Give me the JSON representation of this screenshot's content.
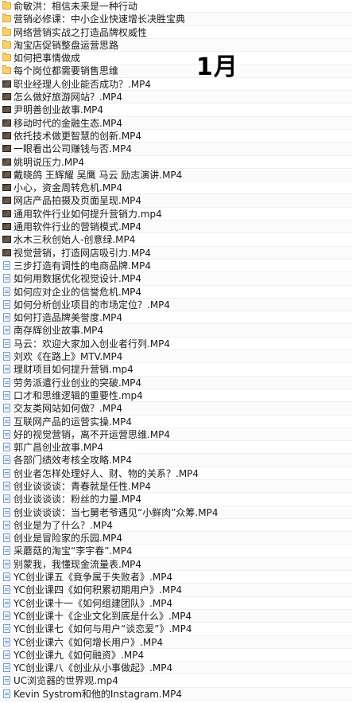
{
  "month_label": "1月",
  "files": [
    {
      "name": "俞敏洪：相信未来是一种行动",
      "icon": "folder-icon"
    },
    {
      "name": "营销必修课：中小企业快速增长决胜宝典",
      "icon": "folder-icon"
    },
    {
      "name": "网络营销实战之打造品牌权威性",
      "icon": "folder-icon"
    },
    {
      "name": "淘宝店促销整盘运营思路",
      "icon": "folder-icon"
    },
    {
      "name": "如何把事情做成",
      "icon": "folder-icon"
    },
    {
      "name": "每个岗位都需要销售思维",
      "icon": "folder-icon"
    },
    {
      "name": "职业经理人创业能否成功？.MP4",
      "icon": "video-icon"
    },
    {
      "name": "怎么做好旅游网站？.MP4",
      "icon": "video-icon"
    },
    {
      "name": "尹明善创业故事.MP4",
      "icon": "video-icon"
    },
    {
      "name": "移动时代的金融生态.MP4",
      "icon": "video-icon"
    },
    {
      "name": "依托技术做更智慧的创新.MP4",
      "icon": "video-icon"
    },
    {
      "name": "一眼看出公司赚钱与否.MP4",
      "icon": "video-icon"
    },
    {
      "name": "姚明说压力.MP4",
      "icon": "video-icon"
    },
    {
      "name": "戴晓鸽 王辉耀 吴鹰 马云 励志演讲.MP4",
      "icon": "video-icon"
    },
    {
      "name": "小心，资金周转危机.MP4",
      "icon": "video-icon"
    },
    {
      "name": "网店产品拍摄及页面呈现.MP4",
      "icon": "video-icon"
    },
    {
      "name": "通用软件行业如何提升营销力.mp4",
      "icon": "video-icon"
    },
    {
      "name": "通用软件行业的营销模式.MP4",
      "icon": "video-icon"
    },
    {
      "name": "水木三秋创始人-创意绿.MP4",
      "icon": "video-icon"
    },
    {
      "name": "视觉营销，打造网店吸引力.MP4",
      "icon": "video-icon"
    },
    {
      "name": "三步打造有调性的电商品牌.MP4",
      "icon": "document-icon"
    },
    {
      "name": "如何用数据优化视觉设计.MP4",
      "icon": "document-icon"
    },
    {
      "name": "如何应对企业的信誉危机.MP4",
      "icon": "document-icon"
    },
    {
      "name": "如何分析创业项目的市场定位？.MP4",
      "icon": "document-icon"
    },
    {
      "name": "如何打造品牌美誉度.MP4",
      "icon": "document-icon"
    },
    {
      "name": "南存辉创业故事.MP4",
      "icon": "document-icon"
    },
    {
      "name": "马云：欢迎大家加入创业者行列.MP4",
      "icon": "document-icon"
    },
    {
      "name": "刘欢《在路上》MTV.MP4",
      "icon": "document-icon"
    },
    {
      "name": "理财项目如何提升营销.mp4",
      "icon": "document-icon"
    },
    {
      "name": "劳务派遣行业创业的突破.MP4",
      "icon": "document-icon"
    },
    {
      "name": "口才和思维逻辑的重要性.mp4",
      "icon": "document-icon"
    },
    {
      "name": "交友类网站如何做？.MP4",
      "icon": "document-icon"
    },
    {
      "name": "互联网产品的运营实操.MP4",
      "icon": "document-icon"
    },
    {
      "name": "好的视觉营销，离不开运营思维.MP4",
      "icon": "document-icon"
    },
    {
      "name": "郭广昌创业故事.MP4",
      "icon": "document-icon"
    },
    {
      "name": "各部门绩效考核全攻略.MP4",
      "icon": "document-icon"
    },
    {
      "name": "创业者怎样处理好人、财、物的关系？.MP4",
      "icon": "document-icon"
    },
    {
      "name": "创业谈谈谈：青春就是任性.MP4",
      "icon": "document-icon"
    },
    {
      "name": "创业谈谈谈：粉丝的力量.MP4",
      "icon": "document-icon"
    },
    {
      "name": "创业谈谈谈：当七舅老爷遇见“小鲜肉”众筹.MP4",
      "icon": "document-icon"
    },
    {
      "name": "创业是为了什么？.MP4",
      "icon": "document-icon"
    },
    {
      "name": "创业是冒险家的乐园.MP4",
      "icon": "document-icon"
    },
    {
      "name": "采蘑菇的淘宝“李宇春”.MP4",
      "icon": "document-icon"
    },
    {
      "name": "别蒙我，我懂现金流量表.MP4",
      "icon": "document-icon"
    },
    {
      "name": "YC创业课五《竟争属于失败者》.MP4",
      "icon": "document-icon"
    },
    {
      "name": "YC创业课四《如何积累初期用户》.MP4",
      "icon": "document-icon"
    },
    {
      "name": "YC创业课十一《如何组建团队》.MP4",
      "icon": "document-icon"
    },
    {
      "name": "YC创业课十《企业文化到底是什么》.MP4",
      "icon": "document-icon"
    },
    {
      "name": "YC创业课七《如何与用户“谈恋爱”》.MP4",
      "icon": "document-icon"
    },
    {
      "name": "YC创业课六《如何增长用户》.MP4",
      "icon": "document-icon"
    },
    {
      "name": "YC创业课九《如何融资》.MP4",
      "icon": "document-icon"
    },
    {
      "name": "YC创业课八《创业从小事做起》.MP4",
      "icon": "document-icon"
    },
    {
      "name": "UC浏览器的世界观.mp4",
      "icon": "document-icon"
    },
    {
      "name": "Kevin Systrom和他的Instagram.MP4",
      "icon": "document-icon"
    }
  ]
}
